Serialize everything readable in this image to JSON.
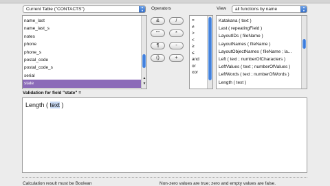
{
  "table_select": {
    "value": "Current Table (\"CONTACTS\")"
  },
  "operators_label": "Operators",
  "view": {
    "label": "View",
    "value": "all functions by name"
  },
  "fields": [
    {
      "name": "name_last",
      "selected": false
    },
    {
      "name": "name_last_s",
      "selected": false
    },
    {
      "name": "notes",
      "selected": false
    },
    {
      "name": "phone",
      "selected": false
    },
    {
      "name": "phone_s",
      "selected": false
    },
    {
      "name": "postal_code",
      "selected": false
    },
    {
      "name": "postal_code_s",
      "selected": false
    },
    {
      "name": "serial",
      "selected": false
    },
    {
      "name": "state",
      "selected": true
    }
  ],
  "operator_buttons": [
    "&",
    "/",
    "\"\"",
    "*",
    "¶",
    "-",
    "()",
    "+"
  ],
  "operator_list": [
    "=",
    "≠",
    ">",
    "<",
    "≥",
    "≤",
    "and",
    "or",
    "xor"
  ],
  "functions": [
    "Katakana ( text )",
    "Last ( repeatingField )",
    "LayoutIDs ( fileName )",
    "LayoutNames ( fileName )",
    "LayoutObjectNames ( fileName ; la...",
    "Left ( text ; numberOfCharacters )",
    "LeftValues ( text ; numberOfValues )",
    "LeftWords ( text ; numberOfWords )",
    "Length ( text )"
  ],
  "validation_label": "Validation for field \"state\" =",
  "calculation": {
    "prefix": "Length ( ",
    "highlight": "text",
    "suffix": " )"
  },
  "bottom": {
    "left": "Calculation result must be Boolean",
    "right": "Non-zero values are true; zero and empty values are false."
  }
}
